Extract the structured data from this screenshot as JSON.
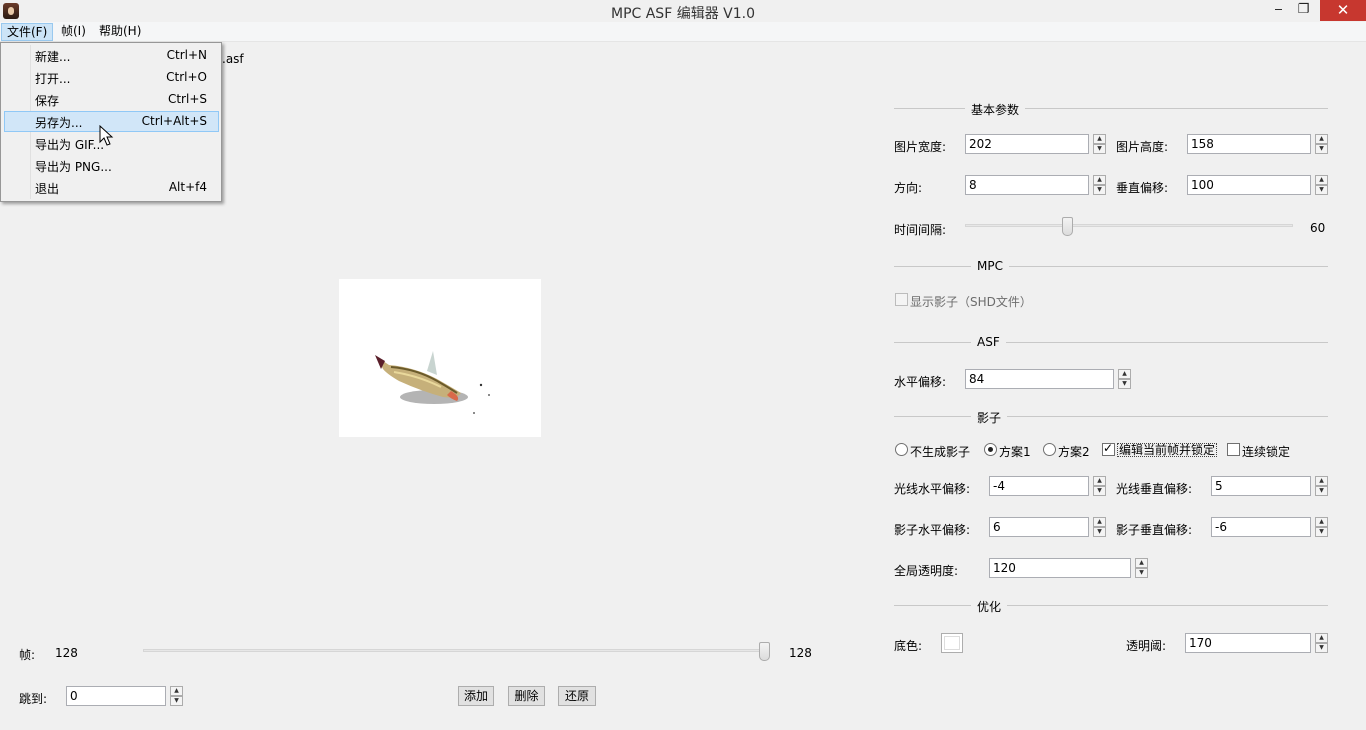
{
  "window": {
    "title": "MPC ASF 编辑器 V1.0",
    "minimize": "‒",
    "maximize": "❐",
    "close": "✕"
  },
  "menubar": {
    "file": "文件(F)",
    "frame": "帧(I)",
    "help": "帮助(H)"
  },
  "current_file_suffix": ".asf",
  "file_menu": [
    {
      "label": "新建...",
      "shortcut": "Ctrl+N"
    },
    {
      "label": "打开...",
      "shortcut": "Ctrl+O"
    },
    {
      "label": "保存",
      "shortcut": "Ctrl+S"
    },
    {
      "label": "另存为...",
      "shortcut": "Ctrl+Alt+S"
    },
    {
      "label": "导出为 GIF...",
      "shortcut": ""
    },
    {
      "label": "导出为 PNG...",
      "shortcut": ""
    },
    {
      "label": "退出",
      "shortcut": "Alt+f4"
    }
  ],
  "bottom": {
    "frame_label": "帧:",
    "frame_value": "128",
    "frame_max": "128",
    "jump_label": "跳到:",
    "jump_value": "0",
    "add": "添加",
    "delete": "删除",
    "restore": "还原"
  },
  "basic": {
    "title": "基本参数",
    "width_label": "图片宽度:",
    "width": "202",
    "height_label": "图片高度:",
    "height": "158",
    "direction_label": "方向:",
    "direction": "8",
    "voffset_label": "垂直偏移:",
    "voffset": "100",
    "interval_label": "时间间隔:",
    "interval": "60",
    "interval_level": 0.31
  },
  "mpc": {
    "title": "MPC",
    "show_shadow": "显示影子（SHD文件）"
  },
  "asf": {
    "title": "ASF",
    "hoffset_label": "水平偏移:",
    "hoffset": "84"
  },
  "shadow": {
    "title": "影子",
    "no_shadow": "不生成影子",
    "scheme1": "方案1",
    "scheme2": "方案2",
    "edit_lock": "编辑当前帧并锁定",
    "continuous_lock": "连续锁定",
    "light_h_label": "光线水平偏移:",
    "light_h": "-4",
    "light_v_label": "光线垂直偏移:",
    "light_v": "5",
    "shadow_h_label": "影子水平偏移:",
    "shadow_h": "6",
    "shadow_v_label": "影子垂直偏移:",
    "shadow_v": "-6",
    "global_alpha_label": "全局透明度:",
    "global_alpha": "120"
  },
  "optimize": {
    "title": "优化",
    "bg_label": "底色:",
    "bg_color": "#ffffff",
    "threshold_label": "透明阈:",
    "threshold": "170"
  }
}
